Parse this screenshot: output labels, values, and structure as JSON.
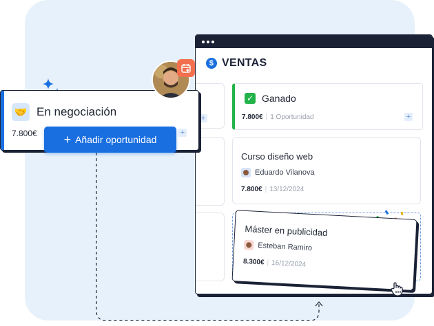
{
  "window": {
    "title": "VENTAS",
    "coin_symbol": "$"
  },
  "negotiation": {
    "stage": "En negociación",
    "amount": "7.800€",
    "add_button": "Añadir oportunidad"
  },
  "won": {
    "stage": "Ganado",
    "amount": "7.800€",
    "count": "1 Oportunidad"
  },
  "deals": [
    {
      "title": "Curso diseño web",
      "owner": "Eduardo Vilanova",
      "amount": "7.800€",
      "date": "13/12/2024"
    },
    {
      "title": "Máster en publicidad",
      "owner": "Esteban Ramiro",
      "amount": "8.300€",
      "date": "16/12/2024"
    }
  ],
  "colors": {
    "accent": "#1a6fe0",
    "won": "#22b34a",
    "dark": "#1b2236",
    "badge": "#f3704f",
    "background": "#e6f1fb"
  },
  "icons": [
    "handshake-icon",
    "check-icon",
    "calendar-plus-icon",
    "dollar-coin-icon",
    "hand-pointer-icon",
    "sparkle-icon",
    "confetti-icon"
  ]
}
